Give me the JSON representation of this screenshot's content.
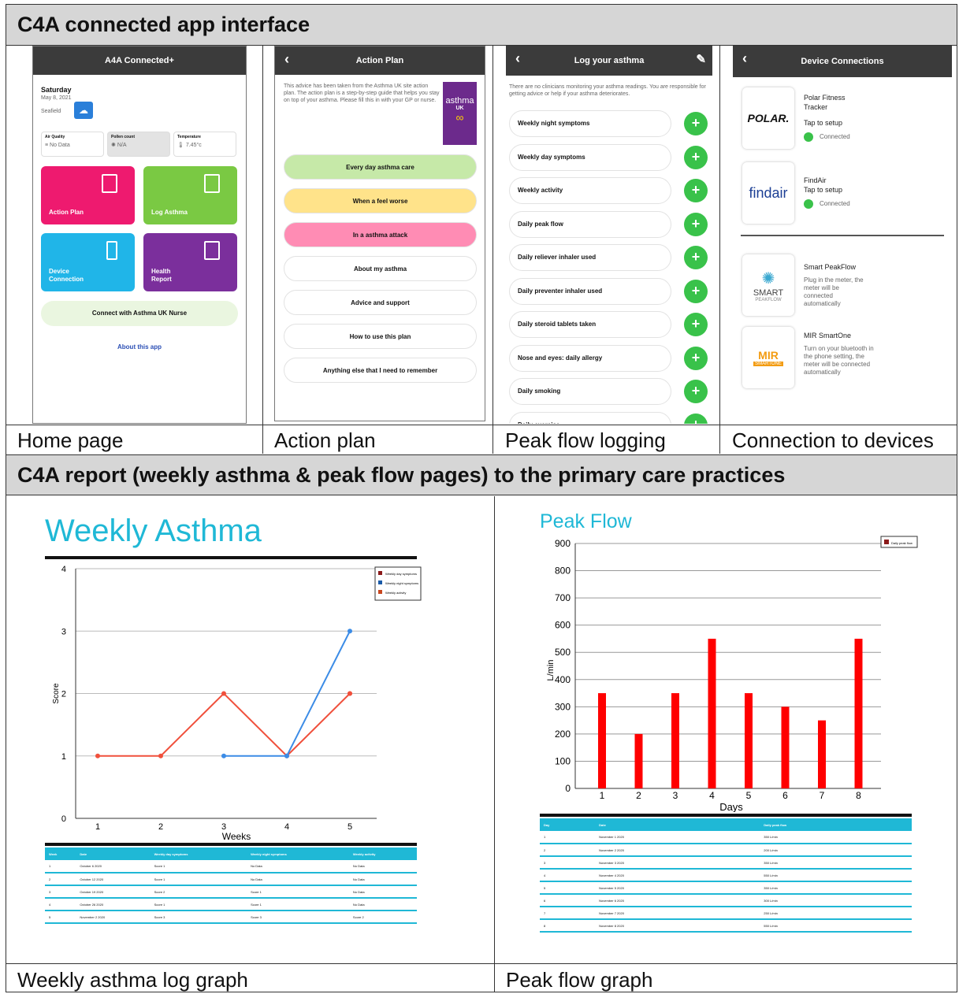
{
  "section1_title": "C4A connected app interface",
  "section2_title": "C4A report (weekly asthma & peak flow pages) to the primary care practices",
  "captions": {
    "home": "Home page",
    "action": "Action plan",
    "peak_logging": "Peak flow logging",
    "devices": "Connection to devices",
    "weekly_graph": "Weekly asthma log graph",
    "peak_graph": "Peak flow graph"
  },
  "home": {
    "title": "A4A Connected+",
    "day": "Saturday",
    "date": "May 8, 2021",
    "location": "Seafield",
    "metrics": [
      {
        "label": "Air Quality",
        "value": "No Data"
      },
      {
        "label": "Pollen count",
        "value": "N/A"
      },
      {
        "label": "Temperature",
        "value": "7.45°c"
      }
    ],
    "tiles": [
      {
        "label": "Action Plan",
        "color": "#ee1a6f"
      },
      {
        "label": "Log Asthma",
        "color": "#7ac943"
      },
      {
        "label": "Device Connection",
        "color": "#20b5e8"
      },
      {
        "label": "Health Report",
        "color": "#7b2f9c"
      }
    ],
    "nurse_button": "Connect with Asthma UK Nurse",
    "about_link": "About this app"
  },
  "action": {
    "title": "Action Plan",
    "intro": "This advice has been taken from the Asthma UK site action plan. The action plan is a step-by-step guide that helps you stay on top of your asthma. Please fill this in with your GP or nurse.",
    "logo_text": "asthma",
    "logo_sub": "UK",
    "items": [
      {
        "label": "Every day asthma care",
        "color": "#c6e9a8"
      },
      {
        "label": "When a feel worse",
        "color": "#ffe38a"
      },
      {
        "label": "In a asthma attack",
        "color": "#ff8cb4"
      },
      {
        "label": "About my asthma",
        "color": "#ffffff"
      },
      {
        "label": "Advice and support",
        "color": "#ffffff"
      },
      {
        "label": "How to use this plan",
        "color": "#ffffff"
      },
      {
        "label": "Anything else that I need to remember",
        "color": "#ffffff"
      }
    ]
  },
  "log": {
    "title": "Log your asthma",
    "notice": "There are no clinicians monitoring your asthma readings. You are responsible for getting advice or help if your asthma deteriorates.",
    "items": [
      "Weekly night symptoms",
      "Weekly day symptoms",
      "Weekly activity",
      "Daily peak flow",
      "Daily reliever inhaler used",
      "Daily preventer inhaler used",
      "Daily steroid tablets taken",
      "Nose and eyes: daily allergy",
      "Daily smoking",
      "Daily exercise"
    ]
  },
  "devices": {
    "title": "Device Connections",
    "list": [
      {
        "logo": "POLAR.",
        "name": "Polar Fitness Tracker",
        "action": "Tap to setup",
        "status": "Connected",
        "logo_color": "#111111"
      },
      {
        "logo": "findair",
        "name": "FindAir",
        "action": "Tap to setup",
        "status": "Connected",
        "logo_color": "#1c3f94"
      },
      {
        "logo": "SMART",
        "logo_sub": "PEAKFLOW",
        "name": "Smart PeakFlow",
        "desc": "Plug in the meter, the meter will be connected automatically",
        "logo_color": "#444444"
      },
      {
        "logo": "MIR",
        "logo_sub": "SMARTONE",
        "name": "MIR SmartOne",
        "desc": "Turn on your bluetooth in the phone setting, the meter will be connected automatically",
        "logo_color": "#f39c12"
      }
    ]
  },
  "weekly_report": {
    "title": "Weekly Asthma",
    "table_headers": [
      "Week",
      "Date",
      "Weekly day symptoms",
      "Weekly night symptoms",
      "Weekly activity"
    ],
    "rows": [
      [
        "1",
        "October 6 2020",
        "Score 1",
        "No Data",
        "No Data"
      ],
      [
        "2",
        "October 12 2020",
        "Score 1",
        "No Data",
        "No Data"
      ],
      [
        "3",
        "October 19 2020",
        "Score 2",
        "Score 1",
        "No Data"
      ],
      [
        "4",
        "October 26 2020",
        "Score 1",
        "Score 1",
        "No Data"
      ],
      [
        "5",
        "November 2 2020",
        "Score 3",
        "Score 3",
        "Score 2"
      ]
    ]
  },
  "peak_report": {
    "title": "Peak Flow",
    "table_headers": [
      "Day",
      "Date",
      "Daily peak flow"
    ],
    "rows": [
      [
        "1",
        "November 1 2020",
        "350 L/min"
      ],
      [
        "2",
        "November 2 2020",
        "200 L/min"
      ],
      [
        "3",
        "November 3 2020",
        "350 L/min"
      ],
      [
        "4",
        "November 4 2020",
        "550 L/min"
      ],
      [
        "5",
        "November 5 2020",
        "350 L/min"
      ],
      [
        "6",
        "November 6 2020",
        "300 L/min"
      ],
      [
        "7",
        "November 7 2020",
        "250 L/min"
      ],
      [
        "8",
        "November 8 2020",
        "550 L/min"
      ]
    ]
  },
  "chart_data": [
    {
      "type": "line",
      "x": [
        1,
        2,
        3,
        4,
        5
      ],
      "xlabel": "Weeks",
      "ylabel": "Score",
      "ylim": [
        0,
        4
      ],
      "yticks": [
        0,
        1,
        2,
        3,
        4
      ],
      "legend_position": "top-right",
      "series": [
        {
          "name": "Weekly day symptoms",
          "color": "#f0503c",
          "values": [
            1,
            1,
            2,
            1,
            2
          ]
        },
        {
          "name": "Weekly night symptoms",
          "color": "#3c8ce6",
          "values": [
            null,
            null,
            1,
            1,
            3
          ]
        },
        {
          "name": "Weekly activity",
          "color": "#f0503c",
          "values": [
            null,
            null,
            null,
            null,
            2
          ]
        }
      ]
    },
    {
      "type": "bar",
      "categories": [
        "1",
        "2",
        "3",
        "4",
        "5",
        "6",
        "7",
        "8"
      ],
      "values": [
        350,
        200,
        350,
        550,
        350,
        300,
        250,
        550
      ],
      "xlabel": "Days",
      "ylabel": "L/min",
      "ylim": [
        0,
        900
      ],
      "yticks": [
        0,
        100,
        200,
        300,
        400,
        500,
        600,
        700,
        800,
        900
      ],
      "color": "#ff0000",
      "legend_position": "top-right",
      "series_name": "Daily peak flow"
    }
  ]
}
